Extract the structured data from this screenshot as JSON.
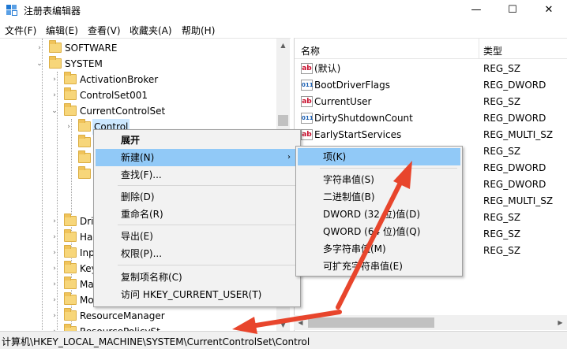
{
  "window": {
    "title": "注册表编辑器",
    "minimize": "—",
    "maximize": "☐",
    "close": "✕"
  },
  "menubar": {
    "items": [
      "文件(F)",
      "编辑(E)",
      "查看(V)",
      "收藏夹(A)",
      "帮助(H)"
    ]
  },
  "tree": {
    "items": [
      {
        "label": "SOFTWARE",
        "expander": "›"
      },
      {
        "label": "SYSTEM",
        "expander": "⌄"
      },
      {
        "label": "ActivationBroker",
        "expander": "›"
      },
      {
        "label": "ControlSet001",
        "expander": "›"
      },
      {
        "label": "CurrentControlSet",
        "expander": "⌄"
      },
      {
        "label": "Control",
        "expander": "›"
      },
      {
        "label": "Dri",
        "expander": "›"
      },
      {
        "label": "Ha",
        "expander": "›"
      },
      {
        "label": "Inp",
        "expander": "›"
      },
      {
        "label": "Key",
        "expander": "›"
      },
      {
        "label": "Ma",
        "expander": "›"
      },
      {
        "label": "Mo",
        "expander": "›"
      },
      {
        "label": "ResourceManager",
        "expander": "›"
      },
      {
        "label": "ResourcePolicySt",
        "expander": "›"
      }
    ]
  },
  "list": {
    "columns": {
      "name": "名称",
      "type": "类型"
    },
    "rows": [
      {
        "name": "(默认)",
        "type": "REG_SZ",
        "icon": "string-value-icon"
      },
      {
        "name": "BootDriverFlags",
        "type": "REG_DWORD",
        "icon": "binary-value-icon"
      },
      {
        "name": "CurrentUser",
        "type": "REG_SZ",
        "icon": "string-value-icon"
      },
      {
        "name": "DirtyShutdownCount",
        "type": "REG_DWORD",
        "icon": "binary-value-icon"
      },
      {
        "name": "EarlyStartServices",
        "type": "REG_MULTI_SZ",
        "icon": "string-value-icon"
      },
      {
        "name": "",
        "type": "REG_SZ",
        "icon": ""
      },
      {
        "name": "",
        "type": "REG_DWORD",
        "icon": ""
      },
      {
        "name": "",
        "type": "REG_DWORD",
        "icon": ""
      },
      {
        "name": "",
        "type": "REG_MULTI_SZ",
        "icon": ""
      },
      {
        "name": "",
        "type": "REG_SZ",
        "icon": ""
      },
      {
        "name": "",
        "type": "REG_SZ",
        "icon": ""
      },
      {
        "name": "",
        "type": "REG_SZ",
        "icon": ""
      }
    ]
  },
  "context_menu": {
    "items": [
      {
        "label": "展开",
        "bold": true
      },
      {
        "label": "新建(N)",
        "submenu": true,
        "highlighted": true
      },
      {
        "label": "查找(F)..."
      },
      {
        "label": "删除(D)"
      },
      {
        "label": "重命名(R)"
      },
      {
        "label": "导出(E)"
      },
      {
        "label": "权限(P)..."
      },
      {
        "label": "复制项名称(C)"
      },
      {
        "label": "访问 HKEY_CURRENT_USER(T)"
      }
    ],
    "submenu_arrow": "›"
  },
  "submenu": {
    "items": [
      {
        "label": "项(K)",
        "highlighted": true
      },
      {
        "label": "字符串值(S)"
      },
      {
        "label": "二进制值(B)"
      },
      {
        "label": "DWORD (32 位)值(D)"
      },
      {
        "label": "QWORD (64 位)值(Q)"
      },
      {
        "label": "多字符串值(M)"
      },
      {
        "label": "可扩充字符串值(E)"
      }
    ]
  },
  "status_bar": {
    "path": "计算机\\HKEY_LOCAL_MACHINE\\SYSTEM\\CurrentControlSet\\Control"
  },
  "colors": {
    "selection": "#cce8ff",
    "menu_highlight": "#91c9f7",
    "annotation_arrow": "#e8452c"
  }
}
